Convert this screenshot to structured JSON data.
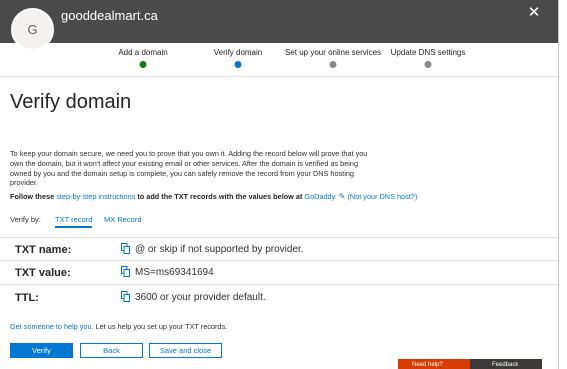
{
  "header": {
    "avatar_letter": "G",
    "domain": "gooddealmart.ca",
    "close_icon": "close-icon",
    "background": "#4a4a4a"
  },
  "steps": [
    {
      "label": "Add a domain",
      "status": "complete",
      "color": "#107c10"
    },
    {
      "label": "Verify domain",
      "status": "current",
      "color": "#0078d4"
    },
    {
      "label": "Set up your online services",
      "status": "pending",
      "color": "#8a8886"
    },
    {
      "label": "Update DNS settings",
      "status": "pending",
      "color": "#8a8886"
    }
  ],
  "page_title": "Verify domain",
  "intro": "To keep your domain secure, we need you to prove that you own it. Adding the record below will prove that you own the domain, but it won't affect your existing email or other services. After the domain is verified as being owned by you and the domain setup is complete, you can safely remove the record from your DNS hosting provider.",
  "follow": {
    "prefix": "Follow these",
    "link": "step-by-step instructions",
    "middle": "to add the TXT records with the values below at",
    "provider": "GoDaddy.",
    "not_host": "(Not your DNS host?)"
  },
  "verify_by": {
    "label": "Verify by:",
    "tabs": [
      "TXT record",
      "MX Record"
    ],
    "selected": "TXT record"
  },
  "records": [
    {
      "label": "TXT name:",
      "value": "@ or skip if not supported by provider."
    },
    {
      "label": "TXT value:",
      "value": "MS=ms69341694"
    },
    {
      "label": "TTL:",
      "value": "3600 or your provider default."
    }
  ],
  "help": {
    "link": "Get someone to help you.",
    "text": "Let us help you set up your TXT records."
  },
  "buttons": {
    "verify": "Verify",
    "back": "Back",
    "save_close": "Save and close"
  },
  "floating": {
    "need_help": "Need help?",
    "feedback": "Feedback"
  },
  "accent": "#0078d4"
}
